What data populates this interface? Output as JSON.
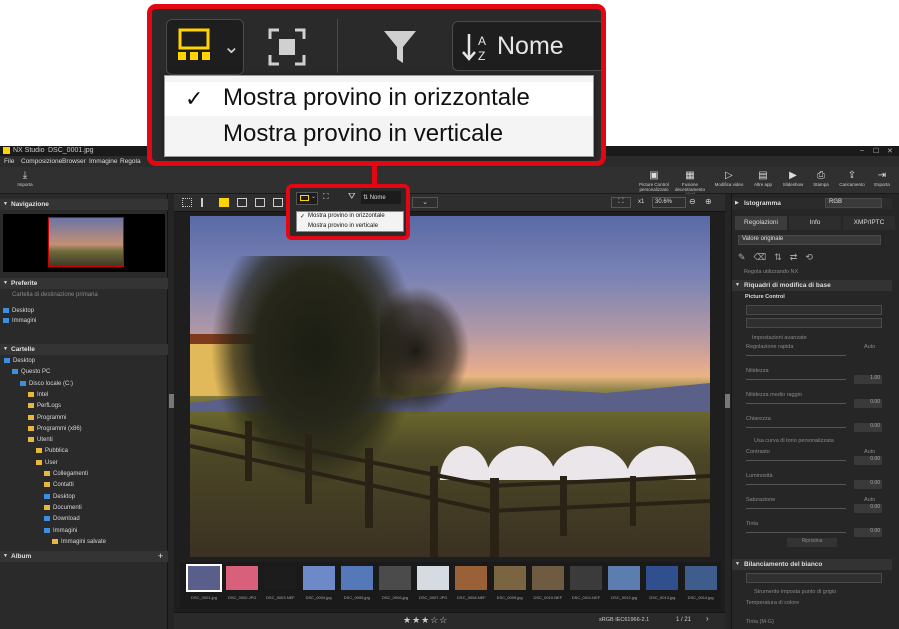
{
  "app": {
    "title": "NX Studio",
    "file": "DSC_0001.jpg",
    "menus": [
      "File",
      "Composizione",
      "Browser",
      "Immagine",
      "Regola"
    ],
    "toolbar_left": "Importa",
    "toolbar_right": [
      {
        "label": "Picture Control personalizzato",
        "icon": "picture-control-icon"
      },
      {
        "label": "Fusione decentramento pixel",
        "icon": "pixel-shift-icon"
      },
      {
        "label": "Modifica video",
        "icon": "video-edit-icon"
      },
      {
        "label": "Altre app",
        "icon": "other-apps-icon"
      },
      {
        "label": "Slideshow",
        "icon": "slideshow-icon"
      },
      {
        "label": "Stampa",
        "icon": "print-icon"
      },
      {
        "label": "Caricamento",
        "icon": "upload-icon"
      },
      {
        "label": "Esporta",
        "icon": "export-icon"
      }
    ]
  },
  "callout": {
    "sort_label": "Nome",
    "menu_items": [
      {
        "label": "Mostra provino in orizzontale",
        "checked": true
      },
      {
        "label": "Mostra provino in verticale",
        "checked": false
      }
    ]
  },
  "left": {
    "navigation_title": "Navigazione",
    "favorites_title": "Preferite",
    "favorites_destination": "Cartella di destinazione primaria",
    "favorites": [
      "Desktop",
      "Immagini"
    ],
    "folders_title": "Cartelle",
    "tree": [
      {
        "label": "Desktop",
        "indent": 0
      },
      {
        "label": "Questo PC",
        "indent": 1
      },
      {
        "label": "Disco locale (C:)",
        "indent": 2
      },
      {
        "label": "Intel",
        "indent": 3
      },
      {
        "label": "PerfLogs",
        "indent": 3
      },
      {
        "label": "Programmi",
        "indent": 3
      },
      {
        "label": "Programmi (x86)",
        "indent": 3
      },
      {
        "label": "Utenti",
        "indent": 3
      },
      {
        "label": "Pubblica",
        "indent": 4
      },
      {
        "label": "User",
        "indent": 4
      },
      {
        "label": "Collegamenti",
        "indent": 5
      },
      {
        "label": "Contatti",
        "indent": 5
      },
      {
        "label": "Desktop",
        "indent": 5
      },
      {
        "label": "Documenti",
        "indent": 5
      },
      {
        "label": "Download",
        "indent": 5
      },
      {
        "label": "Immagini",
        "indent": 5
      },
      {
        "label": "Immagini salvate",
        "indent": 6
      }
    ],
    "album_title": "Album"
  },
  "center": {
    "zoom_ratio": "x1",
    "zoom_percent": "30.6%",
    "sort_label": "Nome",
    "menu_items": [
      "Mostra provino in orizzontale",
      "Mostra provino in verticale"
    ],
    "filmstrip": [
      "DSC_0001.jpg",
      "DSC_0002.JPG",
      "DSC_0003.NEF",
      "DSC_0004.jpg",
      "DSC_0005.jpg",
      "DSC_0006.jpg",
      "DSC_0007.JPG",
      "DSC_0008.NEF",
      "DSC_0009.jpg",
      "DSC_0010.NEF",
      "DSC_0011.NEF",
      "DSC_0012.jpg",
      "DSC_0013.jpg",
      "DSC_0014.jpg"
    ],
    "color_profile": "sRGB IEC61966-2.1",
    "page_counter": "1 / 21",
    "rating_stars": 3
  },
  "right": {
    "histogram_title": "Istogramma",
    "channel": "RGB",
    "tabs": [
      "Regolazioni",
      "Info",
      "XMP/IPTC"
    ],
    "preset": "Valore originale",
    "nef_option": "Regola utilizzando NX",
    "basic_section": "Riquadri di modifica di base",
    "picture_control": "Picture Control",
    "advanced": "Impostazioni avanzate",
    "sliders": [
      {
        "label": "Regolazione rapida",
        "value": "",
        "auto": "Auto"
      },
      {
        "label": "Nitidezza",
        "value": "1.00"
      },
      {
        "label": "Nitidezza medio raggio",
        "value": "0.00"
      },
      {
        "label": "Chiarezza",
        "value": "0.00"
      }
    ],
    "curve_option": "Usa curva di tono personalizzata",
    "sliders2": [
      {
        "label": "Contrasto",
        "value": "0.00",
        "auto": "Auto"
      },
      {
        "label": "Luminosità",
        "value": "0.00"
      },
      {
        "label": "Saturazione",
        "value": "0.00",
        "auto": "Auto"
      },
      {
        "label": "Tinta",
        "value": "0.00"
      }
    ],
    "reset": "Ripristina",
    "wb_section": "Bilanciamento del bianco",
    "gray_point": "Strumento imposta punto di grigio",
    "color_temp": "Temperatura di colore",
    "tint": "Tinta (M-G)"
  }
}
